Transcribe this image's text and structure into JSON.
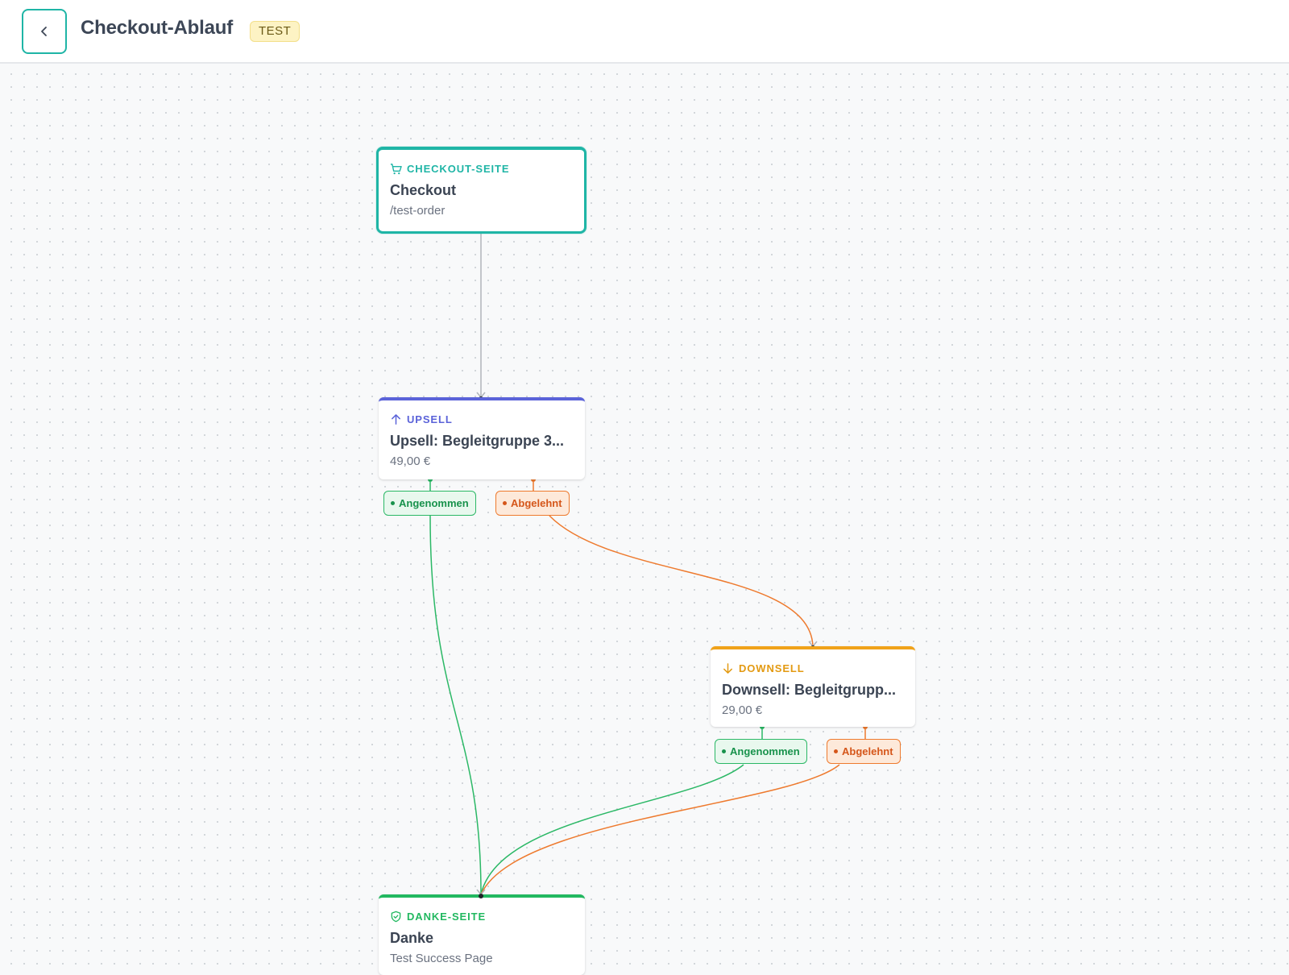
{
  "header": {
    "title": "Checkout-Ablauf",
    "badge": "TEST"
  },
  "colors": {
    "checkout": "#1fb5a6",
    "upsell": "#5b63d9",
    "downsell": "#f0a21a",
    "thanks": "#22b860",
    "accepted": "#2bb866",
    "declined": "#ee7a2e",
    "connector": "#b0b4ba"
  },
  "nodes": {
    "checkout": {
      "kind": "CHECKOUT-SEITE",
      "icon": "cart-icon",
      "name": "Checkout",
      "sub": "/test-order"
    },
    "upsell": {
      "kind": "UPSELL",
      "icon": "arrow-up-icon",
      "name": "Upsell: Begleitgruppe 3...",
      "sub": "49,00 €"
    },
    "downsell": {
      "kind": "DOWNSELL",
      "icon": "arrow-down-icon",
      "name": "Downsell: Begleitgrupp...",
      "sub": "29,00 €"
    },
    "thanks": {
      "kind": "DANKE-SEITE",
      "icon": "shield-check-icon",
      "name": "Danke",
      "sub": "Test Success Page"
    }
  },
  "branches": {
    "accepted": "Angenommen",
    "declined": "Abgelehnt"
  }
}
